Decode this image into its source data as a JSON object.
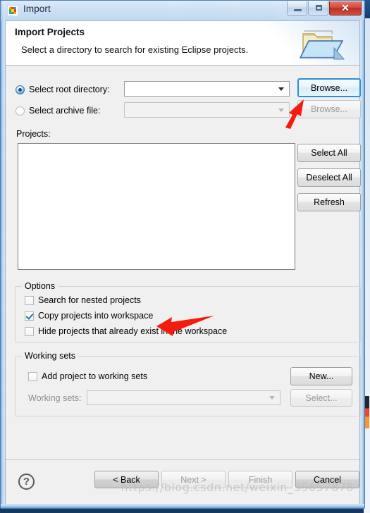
{
  "window": {
    "title": "Import",
    "icon": "nxp-logo-icon",
    "buttons": {
      "minimize": "minimize-icon",
      "maximize": "maximize-icon",
      "close": "✕"
    }
  },
  "header": {
    "title": "Import Projects",
    "subtitle": "Select a directory to search for existing Eclipse projects.",
    "icon": "open-folder-icon"
  },
  "source": {
    "root_directory": {
      "label": "Select root directory:",
      "selected": true,
      "value": "",
      "browse_label": "Browse..."
    },
    "archive_file": {
      "label": "Select archive file:",
      "selected": false,
      "value": "",
      "browse_label": "Browse..."
    }
  },
  "projects": {
    "label": "Projects:",
    "items": [],
    "buttons": {
      "select_all": "Select All",
      "deselect_all": "Deselect All",
      "refresh": "Refresh"
    }
  },
  "options": {
    "legend": "Options",
    "items": [
      {
        "label": "Search for nested projects",
        "checked": false
      },
      {
        "label": "Copy projects into workspace",
        "checked": true
      },
      {
        "label": "Hide projects that already exist in the workspace",
        "checked": false
      }
    ]
  },
  "working_sets": {
    "legend": "Working sets",
    "add_checkbox": {
      "label": "Add project to working sets",
      "checked": false
    },
    "new_label": "New...",
    "sets_label": "Working sets:",
    "sets_value": "",
    "select_label": "Select..."
  },
  "footer": {
    "help": "?",
    "back": "< Back",
    "next": "Next >",
    "finish": "Finish",
    "cancel": "Cancel"
  },
  "watermark": "https://blog.csdn.net/weixin_39657878",
  "colors": {
    "accent": "#2d8fd6",
    "annotation": "#f61c0d",
    "close": "#bb2f20"
  }
}
